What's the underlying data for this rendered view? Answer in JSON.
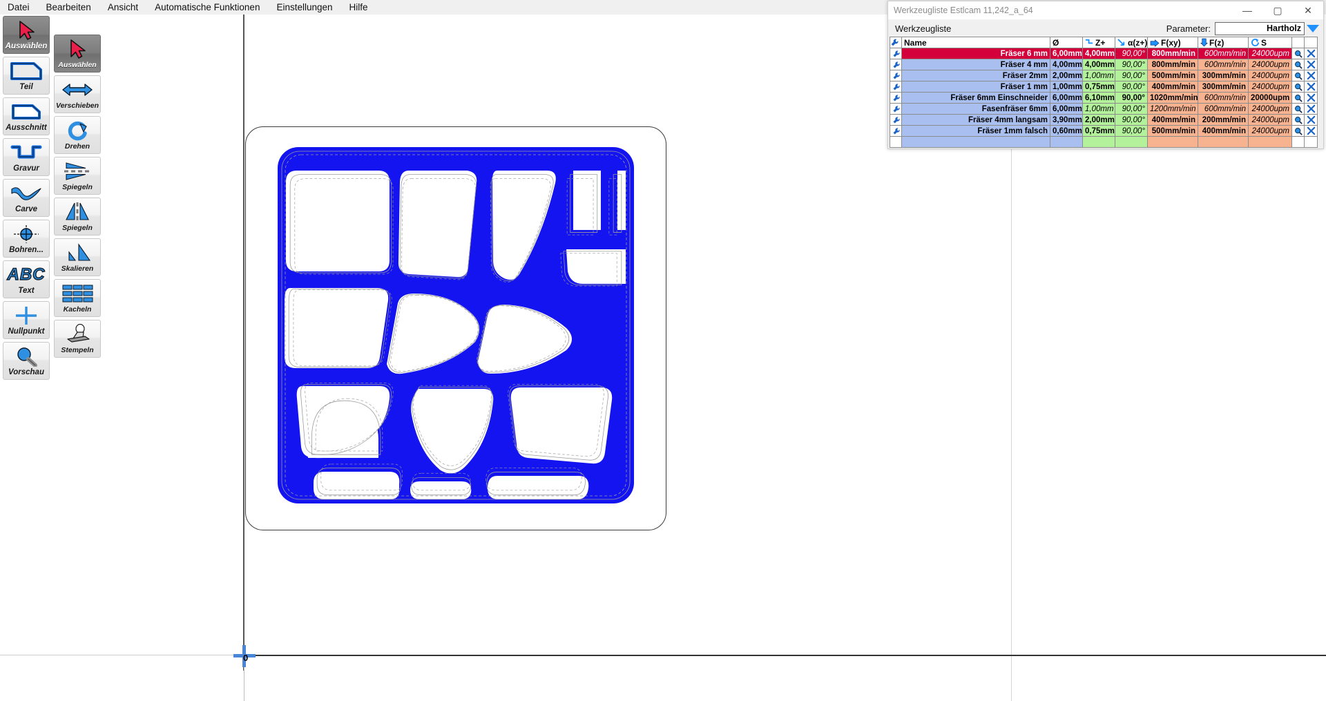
{
  "menubar": {
    "items": [
      {
        "label": "Datei",
        "name": "menu-datei"
      },
      {
        "label": "Bearbeiten",
        "name": "menu-bearbeiten"
      },
      {
        "label": "Ansicht",
        "name": "menu-ansicht"
      },
      {
        "label": "Automatische Funktionen",
        "name": "menu-automatische-funktionen"
      },
      {
        "label": "Einstellungen",
        "name": "menu-einstellungen"
      },
      {
        "label": "Hilfe",
        "name": "menu-hilfe"
      }
    ]
  },
  "toolbar_primary": {
    "items": [
      {
        "label": "Auswählen",
        "icon": "cursor-arrow-icon",
        "selected": true
      },
      {
        "label": "Teil",
        "icon": "part-outline-icon",
        "selected": false
      },
      {
        "label": "Ausschnitt",
        "icon": "cutout-icon",
        "selected": false
      },
      {
        "label": "Gravur",
        "icon": "engrave-icon",
        "selected": false
      },
      {
        "label": "Carve",
        "icon": "carve-icon",
        "selected": false
      },
      {
        "label": "Bohren...",
        "icon": "drill-icon",
        "selected": false
      },
      {
        "label": "Text",
        "icon": "abc-text-icon",
        "selected": false
      },
      {
        "label": "Nullpunkt",
        "icon": "zero-point-icon",
        "selected": false
      },
      {
        "label": "Vorschau",
        "icon": "magnifier-preview-icon",
        "selected": false
      }
    ]
  },
  "toolbar_secondary": {
    "items": [
      {
        "label": "Auswählen",
        "icon": "cursor-arrow-icon",
        "selected": true
      },
      {
        "label": "Verschieben",
        "icon": "move-arrows-icon",
        "selected": false
      },
      {
        "label": "Drehen",
        "icon": "rotate-icon",
        "selected": false
      },
      {
        "label": "Spiegeln",
        "icon": "mirror-horizontal-icon",
        "selected": false
      },
      {
        "label": "Spiegeln",
        "icon": "mirror-vertical-icon",
        "selected": false
      },
      {
        "label": "Skalieren",
        "icon": "scale-icon",
        "selected": false
      },
      {
        "label": "Kacheln",
        "icon": "tile-grid-icon",
        "selected": false
      },
      {
        "label": "Stempeln",
        "icon": "stamp-icon",
        "selected": false
      }
    ]
  },
  "canvas": {
    "origin_label": "0"
  },
  "tool_window": {
    "title": "Werkzeugliste Estlcam 11,242_a_64",
    "minimize": "—",
    "maximize": "▢",
    "close": "✕",
    "sub_label": "Werkzeugliste",
    "parameter_label": "Parameter:",
    "parameter_value": "Hartholz",
    "columns": [
      {
        "label": "",
        "icon": "wrench-icon"
      },
      {
        "label": "Name",
        "icon": ""
      },
      {
        "label": "Ø",
        "icon": ""
      },
      {
        "label": "Z+",
        "icon": "step-z-icon"
      },
      {
        "label": "α(z+)",
        "icon": "plunge-angle-icon"
      },
      {
        "label": "F(xy)",
        "icon": "feed-xy-icon"
      },
      {
        "label": "F(z)",
        "icon": "feed-z-icon"
      },
      {
        "label": "S",
        "icon": "spindle-icon"
      },
      {
        "label": "",
        "icon": "magnifier-icon"
      },
      {
        "label": "",
        "icon": "delete-icon"
      }
    ],
    "rows": [
      {
        "name": "Fräser 6 mm",
        "dia": "6,00mm",
        "z": "4,00mm",
        "a": "90,00°",
        "fxy": "800mm/min",
        "fz": "600mm/min",
        "s": "24000upm",
        "selected": true,
        "style": {
          "z": "bd",
          "a": "it",
          "fxy": "bd",
          "fz": "it",
          "s": "it"
        }
      },
      {
        "name": "Fräser 4 mm",
        "dia": "4,00mm",
        "z": "4,00mm",
        "a": "90,00°",
        "fxy": "800mm/min",
        "fz": "600mm/min",
        "s": "24000upm",
        "selected": false,
        "style": {
          "z": "bd",
          "a": "it",
          "fxy": "bd",
          "fz": "it",
          "s": "it"
        }
      },
      {
        "name": "Fräser 2mm",
        "dia": "2,00mm",
        "z": "1,00mm",
        "a": "90,00°",
        "fxy": "500mm/min",
        "fz": "300mm/min",
        "s": "24000upm",
        "selected": false,
        "style": {
          "z": "it",
          "a": "it",
          "fxy": "bd",
          "fz": "bd",
          "s": "it"
        }
      },
      {
        "name": "Fräser 1 mm",
        "dia": "1,00mm",
        "z": "0,75mm",
        "a": "90,00°",
        "fxy": "400mm/min",
        "fz": "300mm/min",
        "s": "24000upm",
        "selected": false,
        "style": {
          "z": "bd",
          "a": "it",
          "fxy": "bd",
          "fz": "bd",
          "s": "it"
        }
      },
      {
        "name": "Fräser 6mm Einschneider",
        "dia": "6,00mm",
        "z": "6,10mm",
        "a": "90,00°",
        "fxy": "1020mm/min",
        "fz": "600mm/min",
        "s": "20000upm",
        "selected": false,
        "style": {
          "z": "bd",
          "a": "bd",
          "fxy": "bd",
          "fz": "it",
          "s": "bd"
        }
      },
      {
        "name": "Fasenfräser 6mm",
        "dia": "6,00mm",
        "z": "1,00mm",
        "a": "90,00°",
        "fxy": "1200mm/min",
        "fz": "600mm/min",
        "s": "24000upm",
        "selected": false,
        "style": {
          "z": "it",
          "a": "it",
          "fxy": "it",
          "fz": "it",
          "s": "it"
        }
      },
      {
        "name": "Fräser 4mm langsam",
        "dia": "3,90mm",
        "z": "2,00mm",
        "a": "90,00°",
        "fxy": "400mm/min",
        "fz": "200mm/min",
        "s": "24000upm",
        "selected": false,
        "style": {
          "z": "bd",
          "a": "it",
          "fxy": "bd",
          "fz": "bd",
          "s": "it"
        }
      },
      {
        "name": "Fräser 1mm falsch",
        "dia": "0,60mm",
        "z": "0,75mm",
        "a": "90,00°",
        "fxy": "500mm/min",
        "fz": "400mm/min",
        "s": "24000upm",
        "selected": false,
        "style": {
          "z": "bd",
          "a": "it",
          "fxy": "bd",
          "fz": "bd",
          "s": "it"
        }
      }
    ]
  }
}
